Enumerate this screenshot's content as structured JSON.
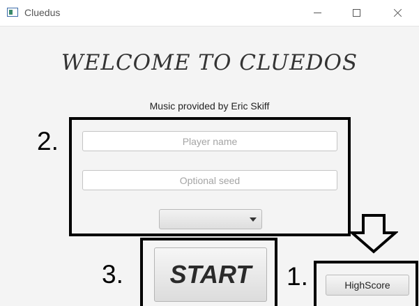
{
  "window": {
    "title": "Cluedus"
  },
  "welcome_text": "WELCOME TO CLUEDOS",
  "music_credit": "Music provided by Eric Skiff",
  "form": {
    "player_name_placeholder": "Player name",
    "seed_placeholder": "Optional seed",
    "dropdown_selected": ""
  },
  "buttons": {
    "start_label": "START",
    "highscore_label": "HighScore"
  },
  "annotations": {
    "marker_1": "1.",
    "marker_2": "2.",
    "marker_3": "3."
  },
  "icons": {
    "app": "window-app-icon",
    "dropdown": "chevron-down-icon",
    "annotation_arrow": "arrow-down-icon"
  }
}
